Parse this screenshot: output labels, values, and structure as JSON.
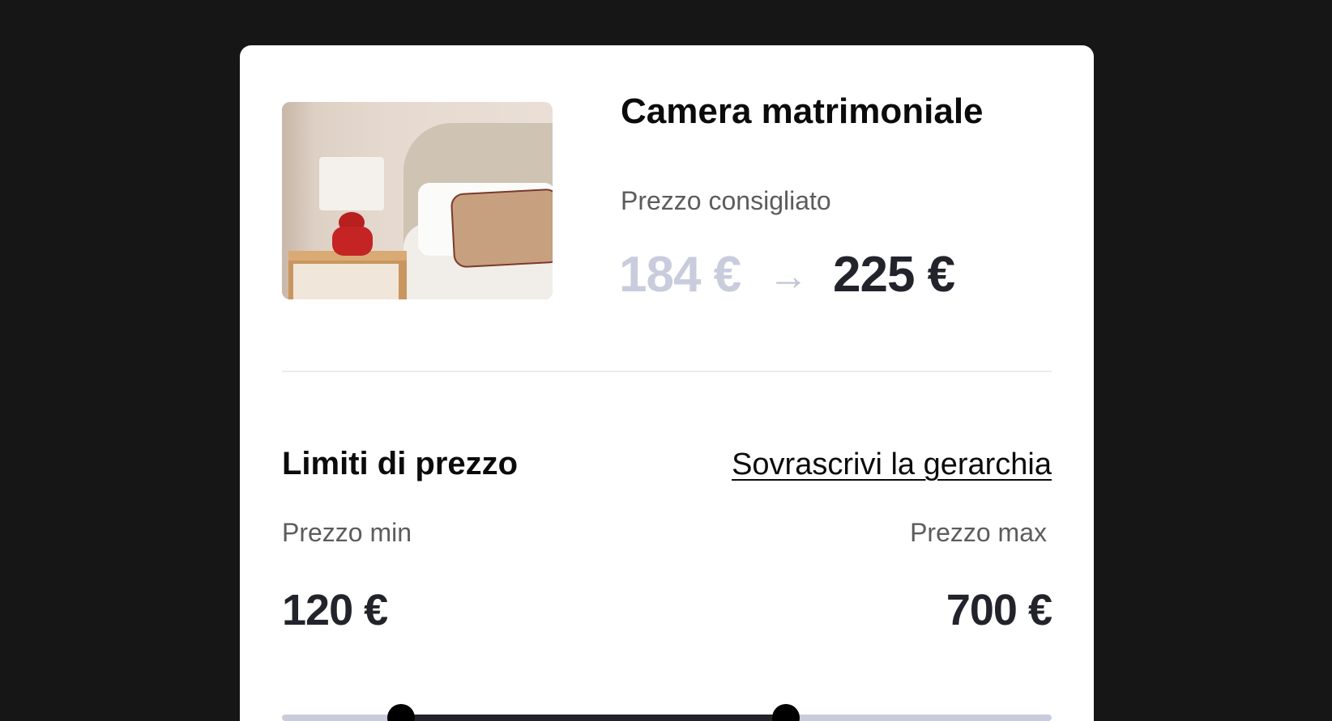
{
  "room": {
    "title": "Camera matrimoniale",
    "subtitle": "Prezzo consigliato",
    "old_price": "184 €",
    "arrow": "→",
    "new_price": "225 €"
  },
  "limits": {
    "title": "Limiti di prezzo",
    "override_link": "Sovrascrivi la gerarchia",
    "min_label": "Prezzo min",
    "max_label": "Prezzo max",
    "min_value": "120 €",
    "max_value": "700 €"
  },
  "slider": {
    "low_fraction": 0.155,
    "high_fraction": 0.655
  },
  "colors": {
    "background": "#161616",
    "card": "#ffffff",
    "old_price": "#c8ccdc",
    "new_price": "#23232b",
    "track": "#c9ccdb",
    "range": "#23232b",
    "thumb": "#000000"
  }
}
